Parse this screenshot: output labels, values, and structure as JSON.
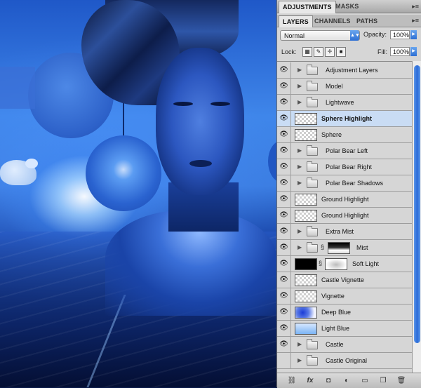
{
  "panel_tabs": {
    "adjustments": "ADJUSTMENTS",
    "masks": "MASKS",
    "menu_glyph": "▸≡"
  },
  "layer_tabs": {
    "layers": "LAYERS",
    "channels": "CHANNELS",
    "paths": "PATHS",
    "menu_glyph": "▸≡"
  },
  "options": {
    "blend_mode": "Normal",
    "opacity_label": "Opacity:",
    "opacity_value": "100%",
    "lock_label": "Lock:",
    "fill_label": "Fill:",
    "fill_value": "100%"
  },
  "layers": [
    {
      "name": "Adjustment Layers",
      "type": "group",
      "visible": true
    },
    {
      "name": "Model",
      "type": "group",
      "visible": true
    },
    {
      "name": "Lightwave",
      "type": "group",
      "visible": true
    },
    {
      "name": "Sphere Highlight",
      "type": "layer",
      "visible": true,
      "selected": true
    },
    {
      "name": "Sphere",
      "type": "layer",
      "visible": true
    },
    {
      "name": "Polar Bear Left",
      "type": "group",
      "visible": true
    },
    {
      "name": "Polar Bear Right",
      "type": "group",
      "visible": true
    },
    {
      "name": "Polar Bear Shadows",
      "type": "group",
      "visible": true
    },
    {
      "name": "Ground Highlight",
      "type": "layer",
      "visible": true
    },
    {
      "name": "Ground Highlight",
      "type": "layer",
      "visible": true
    },
    {
      "name": "Extra Mist",
      "type": "group",
      "visible": true
    },
    {
      "name": "Mist",
      "type": "group-mask",
      "visible": true
    },
    {
      "name": "Soft Light",
      "type": "fill-mask",
      "visible": true
    },
    {
      "name": "Castle Vignette",
      "type": "layer",
      "visible": true
    },
    {
      "name": "Vignette",
      "type": "layer",
      "visible": true
    },
    {
      "name": "Deep Blue",
      "type": "layer",
      "visible": true
    },
    {
      "name": "Light Blue",
      "type": "layer",
      "visible": true
    },
    {
      "name": "Castle",
      "type": "group",
      "visible": true
    },
    {
      "name": "Castle Original",
      "type": "group",
      "visible": false
    }
  ],
  "bottom_icons": [
    "link-icon",
    "fx-icon",
    "add-mask-icon",
    "adjustment-icon",
    "new-group-icon",
    "new-layer-icon",
    "trash-icon"
  ],
  "glyphs": {
    "eye": "👁",
    "triangle": "▶",
    "chain": "§",
    "fx": "fx"
  }
}
